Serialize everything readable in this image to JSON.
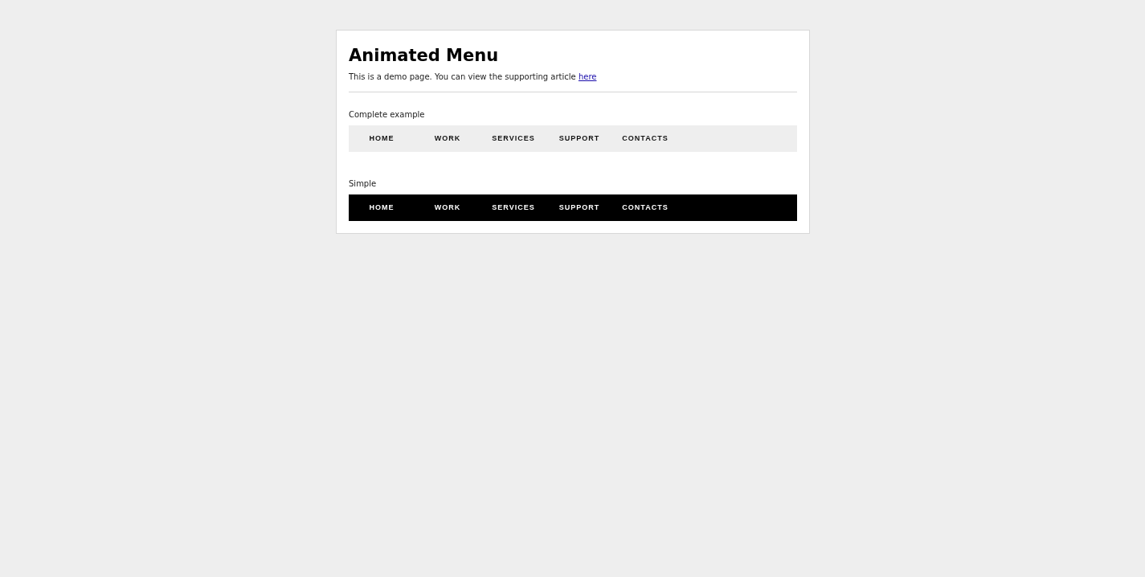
{
  "title": "Animated Menu",
  "intro": {
    "text": "This is a demo page. You can view the supporting article",
    "link": "here"
  },
  "menus": [
    {
      "label": "Complete example",
      "kind": "light",
      "items": [
        "HOME",
        "WORK",
        "SERVICES",
        "SUPPORT",
        "CONTACTS"
      ]
    },
    {
      "label": "Simple",
      "kind": "dark",
      "items": [
        "HOME",
        "WORK",
        "SERVICES",
        "SUPPORT",
        "CONTACTS"
      ]
    }
  ]
}
